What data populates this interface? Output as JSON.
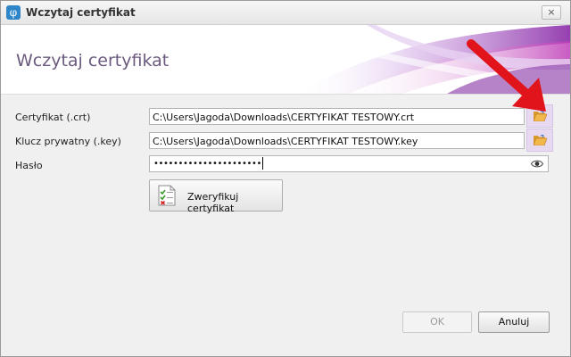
{
  "window": {
    "title": "Wczytaj certyfikat",
    "close_glyph": "×",
    "app_icon": "phi-logo-icon",
    "app_icon_glyph": "φ"
  },
  "banner": {
    "heading": "Wczytaj certyfikat"
  },
  "form": {
    "certificate": {
      "label": "Certyfikat (.crt)",
      "value": "C:\\Users\\Jagoda\\Downloads\\CERTYFIKAT TESTOWY.crt",
      "browse_icon": "open-folder-icon"
    },
    "private_key": {
      "label": "Klucz prywatny (.key)",
      "value": "C:\\Users\\Jagoda\\Downloads\\CERTYFIKAT TESTOWY.key",
      "browse_icon": "open-folder-icon"
    },
    "password": {
      "label": "Hasło",
      "masked_value": "••••••••••••••••••••••",
      "toggle_icon": "eye-icon"
    }
  },
  "verify_button": {
    "label": "Zweryfikuj certyfikat",
    "icon": "checklist-document-icon"
  },
  "footer": {
    "ok_label": "OK",
    "cancel_label": "Anuluj"
  },
  "colors": {
    "banner_title": "#6b5a7e",
    "folder_highlight": "#e6d9f0",
    "annotation_arrow": "#e0141a"
  }
}
